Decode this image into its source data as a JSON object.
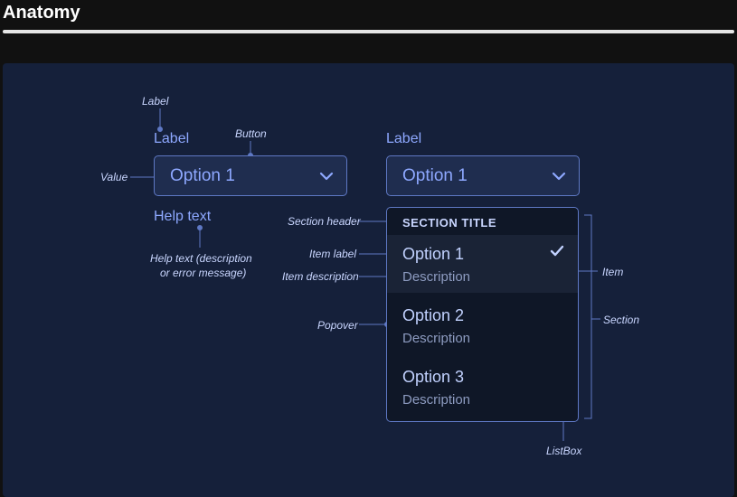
{
  "page": {
    "title": "Anatomy"
  },
  "annotations": {
    "label": "Label",
    "button": "Button",
    "value": "Value",
    "help_text_line1": "Help text (description",
    "help_text_line2": "or error message)",
    "section_header": "Section header",
    "item_label": "Item label",
    "item_description": "Item description",
    "popover": "Popover",
    "item": "Item",
    "section": "Section",
    "listbox": "ListBox"
  },
  "picker_closed": {
    "label": "Label",
    "value": "Option 1",
    "help_text": "Help text"
  },
  "picker_open": {
    "label": "Label",
    "value": "Option 1",
    "section_title": "SECTION TITLE",
    "items": [
      {
        "label": "Option 1",
        "description": "Description",
        "selected": true
      },
      {
        "label": "Option 2",
        "description": "Description",
        "selected": false
      },
      {
        "label": "Option 3",
        "description": "Description",
        "selected": false
      }
    ]
  },
  "colors": {
    "page_background": "#111111",
    "panel_background": "#15203a",
    "accent": "#8ea8ff",
    "annotation_line": "#5e78c4"
  }
}
